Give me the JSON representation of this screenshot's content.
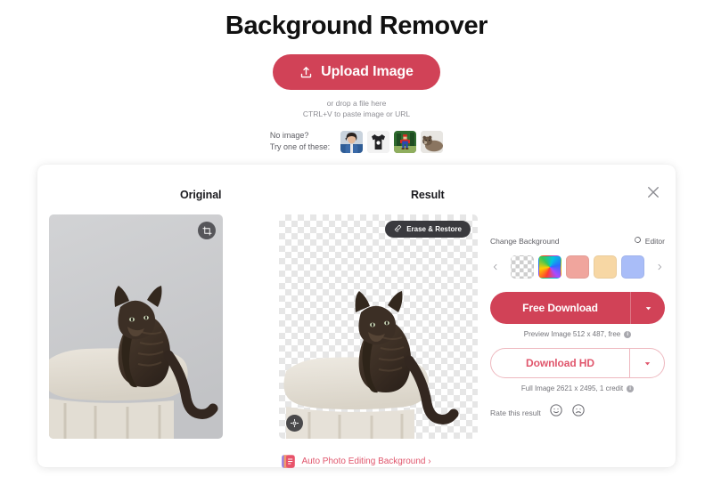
{
  "header": {
    "title": "Background Remover",
    "upload_button_label": "Upload Image",
    "upload_icon": "upload-icon",
    "drop_hint_line1": "or drop a file here",
    "drop_hint_line2": "CTRL+V to paste image or URL"
  },
  "samples": {
    "label_line1": "No image?",
    "label_line2": "Try one of these:",
    "thumbs": [
      {
        "name": "sample-person",
        "alt": "person portrait"
      },
      {
        "name": "sample-tshirt",
        "alt": "black t-shirt product"
      },
      {
        "name": "sample-figurine",
        "alt": "mario figurine"
      },
      {
        "name": "sample-animal",
        "alt": "bear animal"
      }
    ]
  },
  "card": {
    "close_icon": "close-icon",
    "original": {
      "title": "Original",
      "crop_icon": "crop-icon"
    },
    "result": {
      "title": "Result",
      "erase_button_label": "Erase & Restore",
      "erase_icon": "eraser-icon",
      "expand_icon": "expand-icon"
    },
    "controls": {
      "change_background_label": "Change Background",
      "editor_label": "Editor",
      "editor_icon": "magic-wand-icon",
      "prev_icon": "chevron-left-icon",
      "next_icon": "chevron-right-icon",
      "swatches": [
        {
          "name": "swatch-transparent",
          "type": "transparent",
          "color": ""
        },
        {
          "name": "swatch-rainbow",
          "type": "rainbow",
          "color": ""
        },
        {
          "name": "swatch-pink",
          "type": "solid",
          "color": "#f0a59d"
        },
        {
          "name": "swatch-tan",
          "type": "solid",
          "color": "#f7d7a4"
        },
        {
          "name": "swatch-blue",
          "type": "solid",
          "color": "#a9bdf8"
        }
      ],
      "free_download_label": "Free Download",
      "free_download_caret": "chevron-down-icon",
      "preview_meta": "Preview Image 512 x 487, free",
      "preview_info_icon": "info-icon",
      "download_hd_label": "Download HD",
      "download_hd_caret": "chevron-down-icon",
      "full_meta": "Full Image 2621 x 2495, 1 credit",
      "full_info_icon": "info-icon",
      "rate_label": "Rate this result",
      "rate_positive_icon": "smiley-face-icon",
      "rate_negative_icon": "frowny-face-icon"
    }
  },
  "footer": {
    "link_label": "Auto Photo Editing Background ›",
    "link_icon": "photo-editing-icon",
    "link_color": "#e0566c"
  },
  "colors": {
    "accent": "#d14257",
    "accent_light": "#e0566c",
    "text_dark": "#111111",
    "text_muted": "#74747a"
  }
}
